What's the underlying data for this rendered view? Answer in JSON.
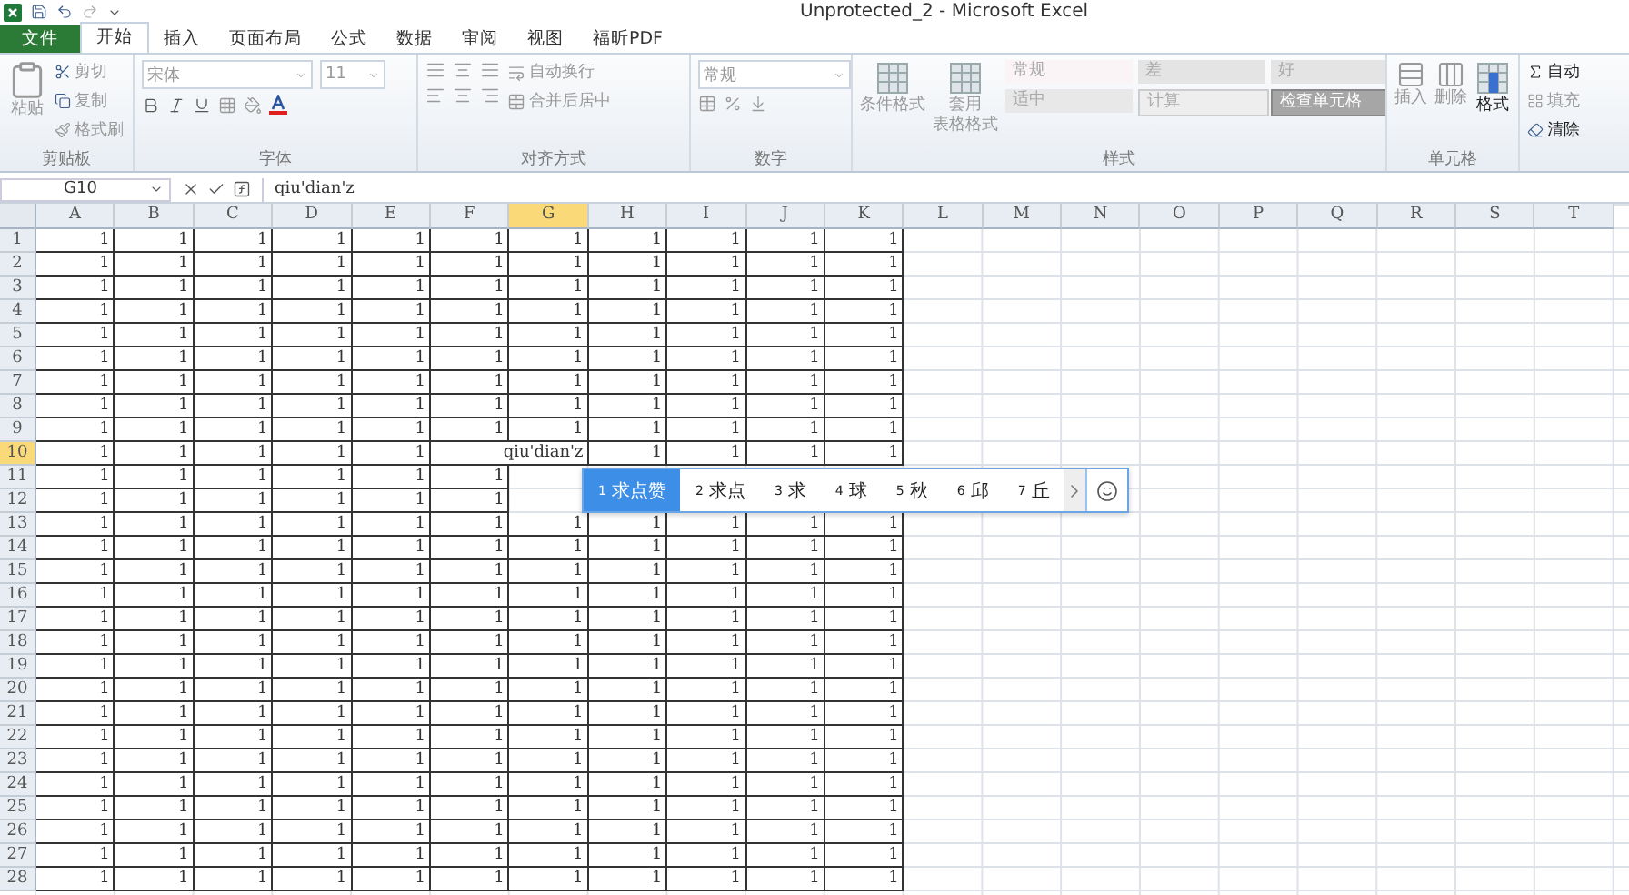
{
  "window": {
    "title": "Unprotected_2 - Microsoft Excel"
  },
  "tabs": [
    {
      "label": "文件",
      "kind": "file",
      "selected": false
    },
    {
      "label": "开始",
      "kind": "tab",
      "selected": true
    },
    {
      "label": "插入",
      "kind": "tab",
      "selected": false
    },
    {
      "label": "页面布局",
      "kind": "tab",
      "selected": false
    },
    {
      "label": "公式",
      "kind": "tab",
      "selected": false
    },
    {
      "label": "数据",
      "kind": "tab",
      "selected": false
    },
    {
      "label": "审阅",
      "kind": "tab",
      "selected": false
    },
    {
      "label": "视图",
      "kind": "tab",
      "selected": false
    },
    {
      "label": "福昕PDF",
      "kind": "tab",
      "selected": false
    }
  ],
  "ribbon": {
    "clipboard": {
      "label": "剪贴板",
      "paste": "粘贴",
      "cut": "剪切",
      "copy": "复制",
      "format_painter": "格式刷"
    },
    "font": {
      "label": "字体",
      "font_name": "宋体",
      "font_size": "11"
    },
    "alignment": {
      "label": "对齐方式",
      "wrap_text": "自动换行",
      "merge_center": "合并后居中"
    },
    "number": {
      "label": "数字",
      "format": "常规"
    },
    "styles": {
      "label": "样式",
      "conditional_format": "条件格式",
      "table_format": [
        "套用",
        "表格格式"
      ],
      "gallery": [
        {
          "label": "常规",
          "kind": "normal"
        },
        {
          "label": "差",
          "kind": "bad"
        },
        {
          "label": "好",
          "kind": "good"
        },
        {
          "label": "适中",
          "kind": "neutral"
        },
        {
          "label": "计算",
          "kind": "calc"
        },
        {
          "label": "检查单元格",
          "kind": "check"
        }
      ]
    },
    "cells": {
      "label": "单元格",
      "insert": "插入",
      "delete": "删除",
      "format": "格式"
    },
    "editing": {
      "autosum": "自动",
      "fill": "填充",
      "clear": "清除"
    }
  },
  "formula_bar": {
    "name_box": "G10",
    "value": "qiu'dian'z"
  },
  "columns": [
    {
      "label": "A",
      "selected": false
    },
    {
      "label": "B",
      "selected": false
    },
    {
      "label": "C",
      "selected": false
    },
    {
      "label": "D",
      "selected": false
    },
    {
      "label": "E",
      "selected": false
    },
    {
      "label": "F",
      "selected": false
    },
    {
      "label": "G",
      "selected": true
    },
    {
      "label": "H",
      "selected": false
    },
    {
      "label": "I",
      "selected": false
    },
    {
      "label": "J",
      "selected": false
    },
    {
      "label": "K",
      "selected": false
    },
    {
      "label": "L",
      "selected": false
    },
    {
      "label": "M",
      "selected": false
    },
    {
      "label": "N",
      "selected": false
    },
    {
      "label": "O",
      "selected": false
    },
    {
      "label": "P",
      "selected": false
    },
    {
      "label": "Q",
      "selected": false
    },
    {
      "label": "R",
      "selected": false
    },
    {
      "label": "S",
      "selected": false
    },
    {
      "label": "T",
      "selected": false
    }
  ],
  "rows": [
    {
      "label": "1",
      "selected": false,
      "cells": [
        "1",
        "1",
        "1",
        "1",
        "1",
        "1",
        "1",
        "1",
        "1",
        "1",
        "1"
      ]
    },
    {
      "label": "2",
      "selected": false,
      "cells": [
        "1",
        "1",
        "1",
        "1",
        "1",
        "1",
        "1",
        "1",
        "1",
        "1",
        "1"
      ]
    },
    {
      "label": "3",
      "selected": false,
      "cells": [
        "1",
        "1",
        "1",
        "1",
        "1",
        "1",
        "1",
        "1",
        "1",
        "1",
        "1"
      ]
    },
    {
      "label": "4",
      "selected": false,
      "cells": [
        "1",
        "1",
        "1",
        "1",
        "1",
        "1",
        "1",
        "1",
        "1",
        "1",
        "1"
      ]
    },
    {
      "label": "5",
      "selected": false,
      "cells": [
        "1",
        "1",
        "1",
        "1",
        "1",
        "1",
        "1",
        "1",
        "1",
        "1",
        "1"
      ]
    },
    {
      "label": "6",
      "selected": false,
      "cells": [
        "1",
        "1",
        "1",
        "1",
        "1",
        "1",
        "1",
        "1",
        "1",
        "1",
        "1"
      ]
    },
    {
      "label": "7",
      "selected": false,
      "cells": [
        "1",
        "1",
        "1",
        "1",
        "1",
        "1",
        "1",
        "1",
        "1",
        "1",
        "1"
      ]
    },
    {
      "label": "8",
      "selected": false,
      "cells": [
        "1",
        "1",
        "1",
        "1",
        "1",
        "1",
        "1",
        "1",
        "1",
        "1",
        "1"
      ]
    },
    {
      "label": "9",
      "selected": false,
      "cells": [
        "1",
        "1",
        "1",
        "1",
        "1",
        "1",
        "1",
        "1",
        "1",
        "1",
        "1"
      ]
    },
    {
      "label": "10",
      "selected": true,
      "cells": [
        "1",
        "1",
        "1",
        "1",
        "1",
        null,
        "qiu'dian'z",
        "1",
        "1",
        "1",
        "1"
      ]
    },
    {
      "label": "11",
      "selected": false,
      "cells": [
        "1",
        "1",
        "1",
        "1",
        "1",
        "1"
      ]
    },
    {
      "label": "12",
      "selected": false,
      "cells": [
        "1",
        "1",
        "1",
        "1",
        "1",
        "1"
      ]
    },
    {
      "label": "13",
      "selected": false,
      "cells": [
        "1",
        "1",
        "1",
        "1",
        "1",
        "1",
        "1",
        "1",
        "1",
        "1",
        "1"
      ]
    },
    {
      "label": "14",
      "selected": false,
      "cells": [
        "1",
        "1",
        "1",
        "1",
        "1",
        "1",
        "1",
        "1",
        "1",
        "1",
        "1"
      ]
    },
    {
      "label": "15",
      "selected": false,
      "cells": [
        "1",
        "1",
        "1",
        "1",
        "1",
        "1",
        "1",
        "1",
        "1",
        "1",
        "1"
      ]
    },
    {
      "label": "16",
      "selected": false,
      "cells": [
        "1",
        "1",
        "1",
        "1",
        "1",
        "1",
        "1",
        "1",
        "1",
        "1",
        "1"
      ]
    },
    {
      "label": "17",
      "selected": false,
      "cells": [
        "1",
        "1",
        "1",
        "1",
        "1",
        "1",
        "1",
        "1",
        "1",
        "1",
        "1"
      ]
    },
    {
      "label": "18",
      "selected": false,
      "cells": [
        "1",
        "1",
        "1",
        "1",
        "1",
        "1",
        "1",
        "1",
        "1",
        "1",
        "1"
      ]
    },
    {
      "label": "19",
      "selected": false,
      "cells": [
        "1",
        "1",
        "1",
        "1",
        "1",
        "1",
        "1",
        "1",
        "1",
        "1",
        "1"
      ]
    },
    {
      "label": "20",
      "selected": false,
      "cells": [
        "1",
        "1",
        "1",
        "1",
        "1",
        "1",
        "1",
        "1",
        "1",
        "1",
        "1"
      ]
    },
    {
      "label": "21",
      "selected": false,
      "cells": [
        "1",
        "1",
        "1",
        "1",
        "1",
        "1",
        "1",
        "1",
        "1",
        "1",
        "1"
      ]
    },
    {
      "label": "22",
      "selected": false,
      "cells": [
        "1",
        "1",
        "1",
        "1",
        "1",
        "1",
        "1",
        "1",
        "1",
        "1",
        "1"
      ]
    },
    {
      "label": "23",
      "selected": false,
      "cells": [
        "1",
        "1",
        "1",
        "1",
        "1",
        "1",
        "1",
        "1",
        "1",
        "1",
        "1"
      ]
    },
    {
      "label": "24",
      "selected": false,
      "cells": [
        "1",
        "1",
        "1",
        "1",
        "1",
        "1",
        "1",
        "1",
        "1",
        "1",
        "1"
      ]
    },
    {
      "label": "25",
      "selected": false,
      "cells": [
        "1",
        "1",
        "1",
        "1",
        "1",
        "1",
        "1",
        "1",
        "1",
        "1",
        "1"
      ]
    },
    {
      "label": "26",
      "selected": false,
      "cells": [
        "1",
        "1",
        "1",
        "1",
        "1",
        "1",
        "1",
        "1",
        "1",
        "1",
        "1"
      ]
    },
    {
      "label": "27",
      "selected": false,
      "cells": [
        "1",
        "1",
        "1",
        "1",
        "1",
        "1",
        "1",
        "1",
        "1",
        "1",
        "1"
      ]
    },
    {
      "label": "28",
      "selected": false,
      "cells": [
        "1",
        "1",
        "1",
        "1",
        "1",
        "1",
        "1",
        "1",
        "1",
        "1",
        "1"
      ]
    }
  ],
  "ime": {
    "candidates": [
      {
        "index": "1",
        "text": "求点赞",
        "selected": true
      },
      {
        "index": "2",
        "text": "求点",
        "selected": false
      },
      {
        "index": "3",
        "text": "求",
        "selected": false
      },
      {
        "index": "4",
        "text": "球",
        "selected": false
      },
      {
        "index": "5",
        "text": "秋",
        "selected": false
      },
      {
        "index": "6",
        "text": "邱",
        "selected": false
      },
      {
        "index": "7",
        "text": "丘",
        "selected": false
      }
    ]
  }
}
